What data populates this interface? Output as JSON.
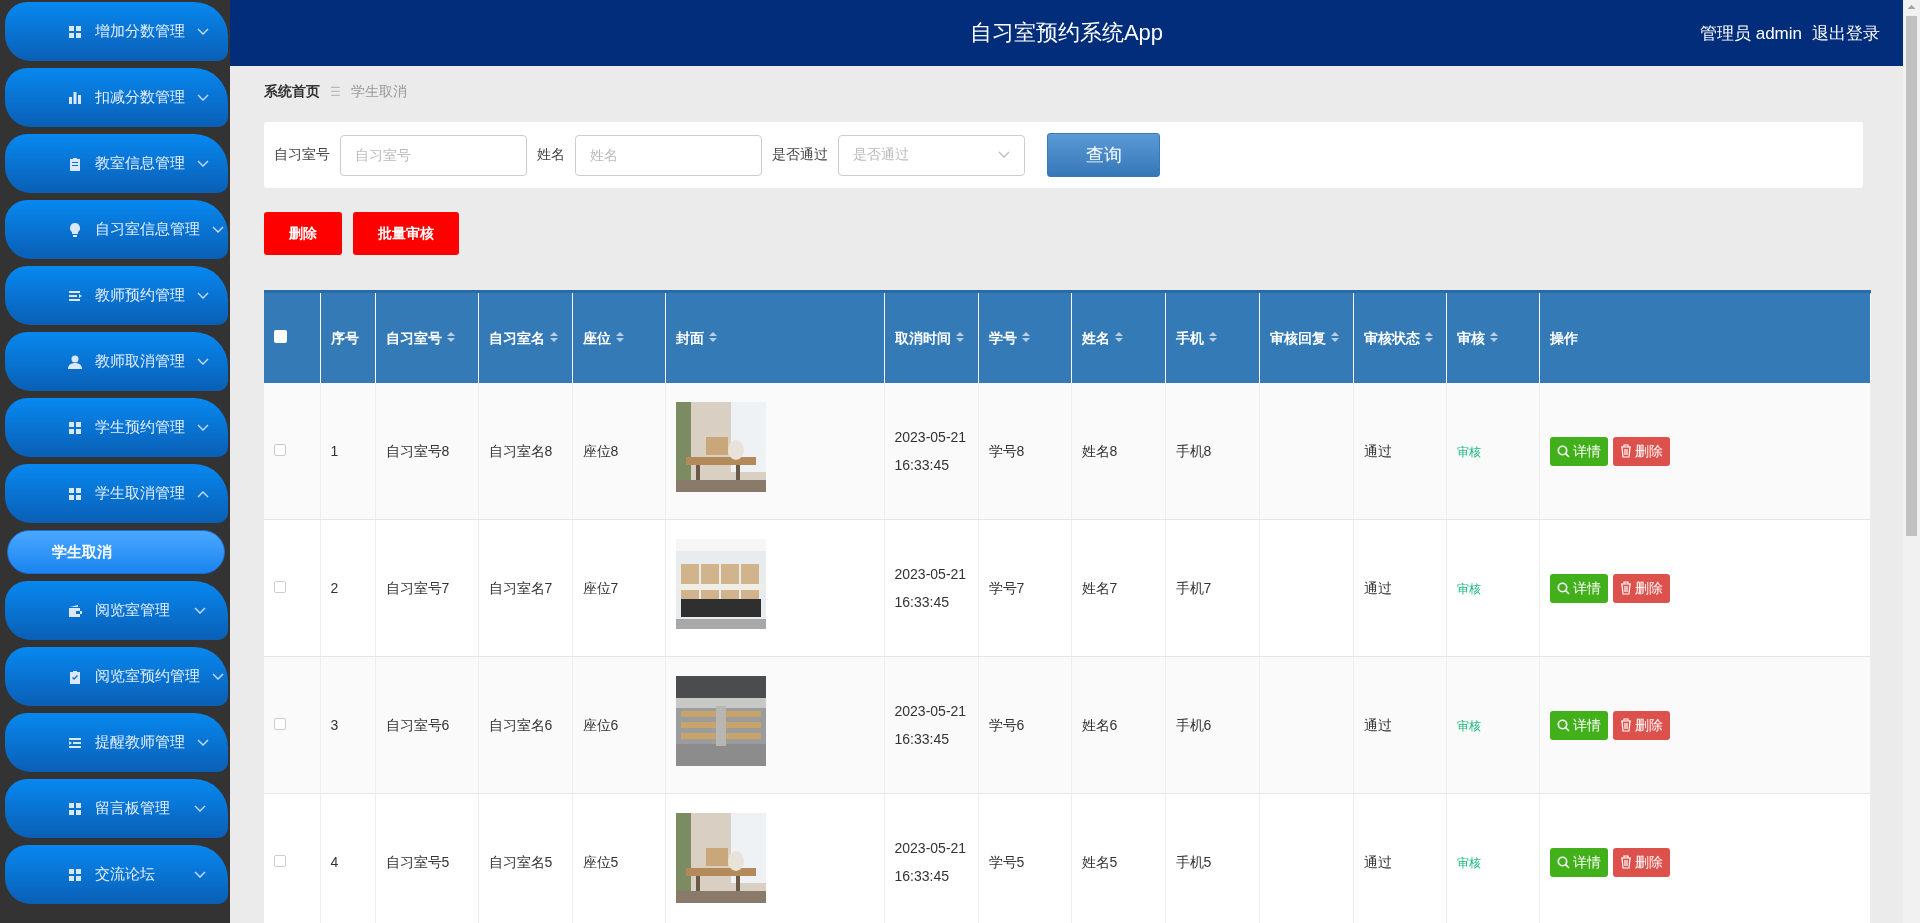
{
  "sidebar": {
    "items": [
      {
        "label": "增加分数管理",
        "expanded": false
      },
      {
        "label": "扣减分数管理",
        "expanded": false
      },
      {
        "label": "教室信息管理",
        "expanded": false
      },
      {
        "label": "自习室信息管理",
        "expanded": false
      },
      {
        "label": "教师预约管理",
        "expanded": false
      },
      {
        "label": "教师取消管理",
        "expanded": false
      },
      {
        "label": "学生预约管理",
        "expanded": false
      },
      {
        "label": "学生取消管理",
        "expanded": true,
        "children": [
          {
            "label": "学生取消",
            "selected": true
          }
        ]
      },
      {
        "label": "阅览室管理",
        "expanded": false
      },
      {
        "label": "阅览室预约管理",
        "expanded": false
      },
      {
        "label": "提醒教师管理",
        "expanded": false
      },
      {
        "label": "留言板管理",
        "expanded": false
      },
      {
        "label": "交流论坛",
        "expanded": false
      }
    ]
  },
  "header": {
    "title": "自习室预约系统App",
    "user": "管理员 admin",
    "logout": "退出登录"
  },
  "breadcrumb": {
    "separator": "☰",
    "items": [
      "系统首页",
      "学生取消"
    ]
  },
  "filters": [
    {
      "label": "自习室号",
      "placeholder": "自习室号",
      "kind": "text"
    },
    {
      "label": "姓名",
      "placeholder": "姓名",
      "kind": "text"
    },
    {
      "label": "是否通过",
      "placeholder": "是否通过",
      "kind": "select"
    }
  ],
  "search_button": "查询",
  "actions": [
    "删除",
    "批量审核"
  ],
  "table": {
    "select_all": {
      "checked": false
    },
    "columns": [
      {
        "label": "序号",
        "sortable": false
      },
      {
        "label": "自习室号",
        "sortable": true
      },
      {
        "label": "自习室名",
        "sortable": true
      },
      {
        "label": "座位",
        "sortable": true
      },
      {
        "label": "封面",
        "sortable": true
      },
      {
        "label": "取消时间",
        "sortable": true
      },
      {
        "label": "学号",
        "sortable": true
      },
      {
        "label": "姓名",
        "sortable": true
      },
      {
        "label": "手机",
        "sortable": true
      },
      {
        "label": "审核回复",
        "sortable": true
      },
      {
        "label": "审核状态",
        "sortable": true
      },
      {
        "label": "审核",
        "sortable": true
      },
      {
        "label": "操作",
        "sortable": false
      }
    ],
    "rows": [
      {
        "checked": false,
        "index": "1",
        "room_no": "自习室号8",
        "room_name": "自习室名8",
        "seat": "座位8",
        "time": "2023-05-21 16:33:45",
        "student_no": "学号8",
        "name": "姓名8",
        "phone": "手机8",
        "status": "通过",
        "review": "审核",
        "detail": "详情",
        "delete": "删除"
      },
      {
        "checked": false,
        "index": "2",
        "room_no": "自习室号7",
        "room_name": "自习室名7",
        "seat": "座位7",
        "time": "2023-05-21 16:33:45",
        "student_no": "学号7",
        "name": "姓名7",
        "phone": "手机7",
        "status": "通过",
        "review": "审核",
        "detail": "详情",
        "delete": "删除"
      },
      {
        "checked": false,
        "index": "3",
        "room_no": "自习室号6",
        "room_name": "自习室名6",
        "seat": "座位6",
        "time": "2023-05-21 16:33:45",
        "student_no": "学号6",
        "name": "姓名6",
        "phone": "手机6",
        "status": "通过",
        "review": "审核",
        "detail": "详情",
        "delete": "删除"
      },
      {
        "checked": false,
        "index": "4",
        "room_no": "自习室号5",
        "room_name": "自习室名5",
        "seat": "座位5",
        "time": "2023-05-21 16:33:45",
        "student_no": "学号5",
        "name": "姓名5",
        "phone": "手机5",
        "status": "通过",
        "review": "审核",
        "detail": "详情",
        "delete": "删除"
      }
    ]
  }
}
